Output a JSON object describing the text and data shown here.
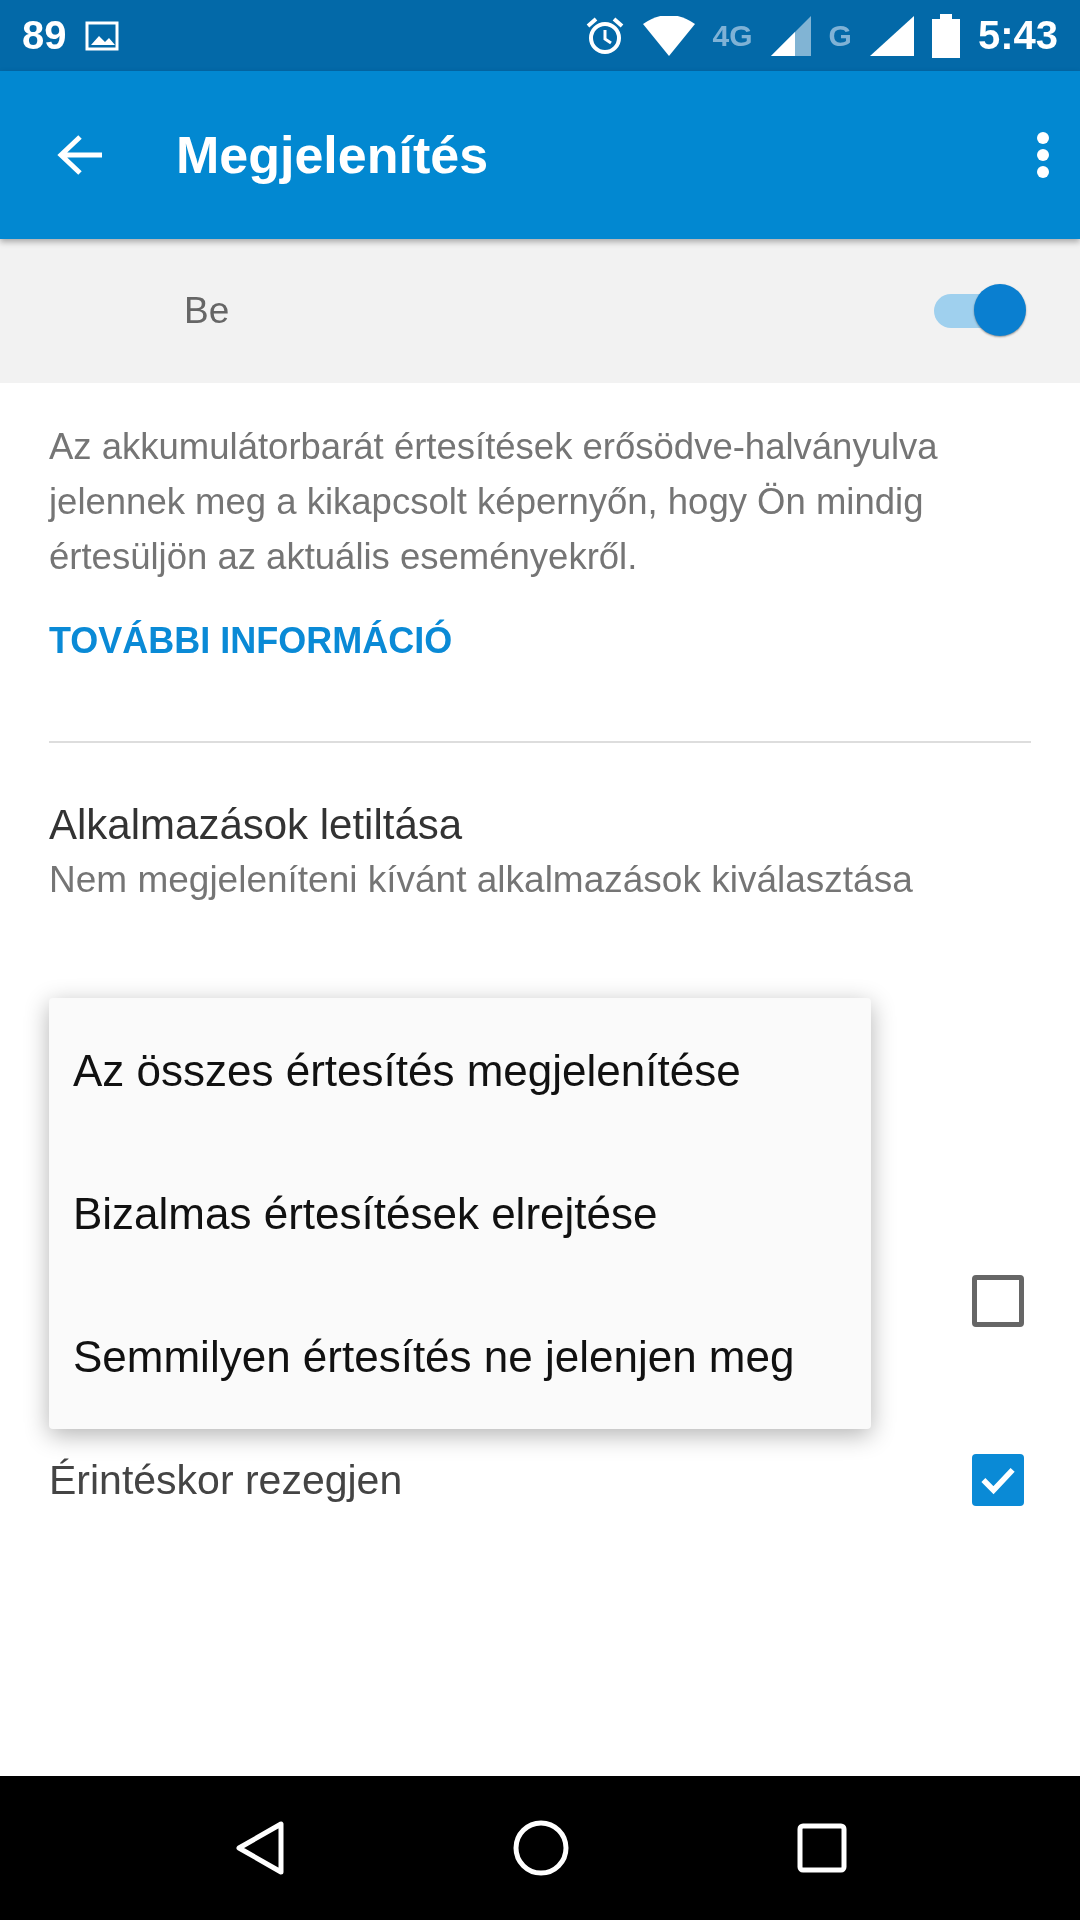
{
  "status_bar": {
    "notification_count": "89",
    "network_1": "4G",
    "network_2": "G",
    "time": "5:43"
  },
  "app_bar": {
    "title": "Megjelenítés"
  },
  "master_switch": {
    "label": "Be",
    "on": true
  },
  "description": "Az akkumulátorbarát értesítések erősödve-halványulva jelennek meg a kikapcsolt képernyőn, hogy Ön mindig értesüljön az aktuális eseményekről.",
  "link": "TOVÁBBI INFORMÁCIÓ",
  "settings": [
    {
      "kind": "item",
      "title": "Alkalmazások letiltása",
      "subtitle": "Nem megjeleníteni kívánt alkalmazások kiválasztása"
    },
    {
      "kind": "checkbox",
      "checked": false
    },
    {
      "kind": "checkbox",
      "title": "Érintéskor rezegjen",
      "checked": true
    }
  ],
  "popup_menu": {
    "items": [
      {
        "label": "Az összes értesítés megjelenítése"
      },
      {
        "label": "Bizalmas értesítések elrejtése"
      },
      {
        "label": "Semmilyen értesítés ne jelenjen meg"
      }
    ]
  }
}
